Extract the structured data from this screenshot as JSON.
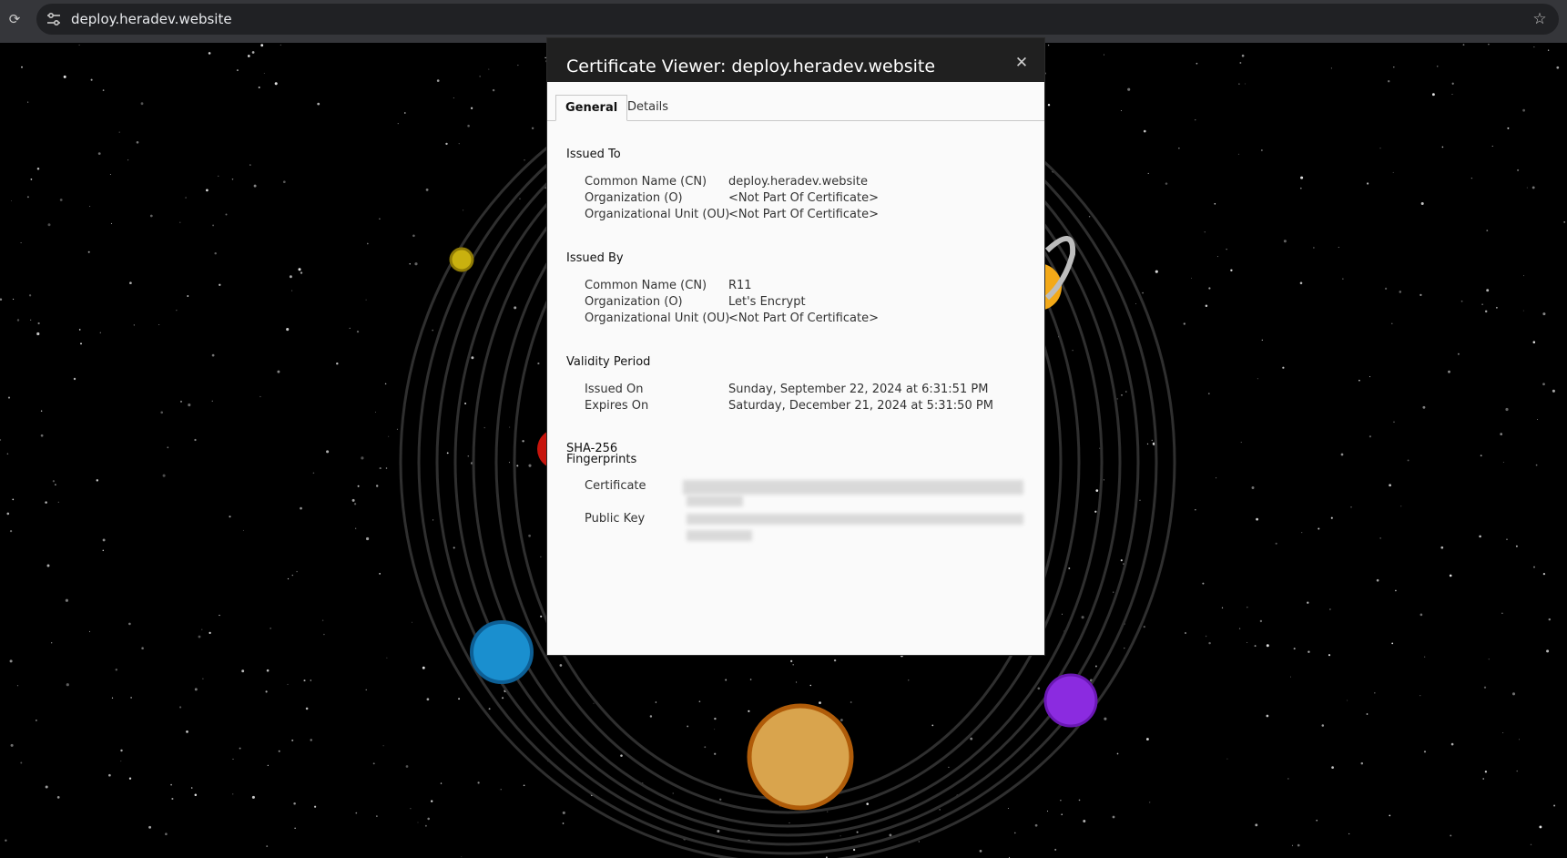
{
  "browser": {
    "url": "deploy.heradev.website",
    "reload_icon": "reload-icon",
    "site_info_icon": "tune-icon",
    "bookmark_icon": "star-icon"
  },
  "dialog": {
    "title": "Certificate Viewer: deploy.heradev.website",
    "close_label": "✕",
    "tabs": [
      {
        "label": "General",
        "active": true
      },
      {
        "label": "Details",
        "active": false
      }
    ],
    "issued_to": {
      "title": "Issued To",
      "rows": [
        {
          "label": "Common Name (CN)",
          "value": "deploy.heradev.website"
        },
        {
          "label": "Organization (O)",
          "value": "<Not Part Of Certificate>"
        },
        {
          "label": "Organizational Unit (OU)",
          "value": "<Not Part Of Certificate>"
        }
      ]
    },
    "issued_by": {
      "title": "Issued By",
      "rows": [
        {
          "label": "Common Name (CN)",
          "value": "R11"
        },
        {
          "label": "Organization (O)",
          "value": "Let's Encrypt"
        },
        {
          "label": "Organizational Unit (OU)",
          "value": "<Not Part Of Certificate>"
        }
      ]
    },
    "validity": {
      "title": "Validity Period",
      "rows": [
        {
          "label": "Issued On",
          "value": "Sunday, September 22, 2024 at 6:31:51 PM"
        },
        {
          "label": "Expires On",
          "value": "Saturday, December 21, 2024 at 5:31:50 PM"
        }
      ]
    },
    "fingerprints": {
      "title_line1": "SHA-256",
      "title_line2": "Fingerprints",
      "rows": [
        {
          "label": "Certificate"
        },
        {
          "label": "Public Key"
        }
      ]
    }
  },
  "colors": {
    "topbar": "#35363a",
    "omnibox": "#202124",
    "dialog_header": "#202020",
    "dialog_body": "#fafafa"
  }
}
